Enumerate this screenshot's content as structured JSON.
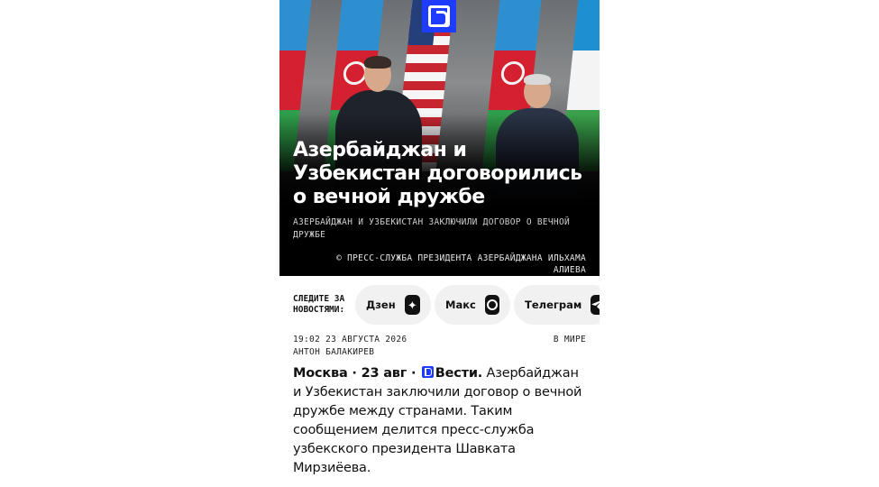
{
  "hero": {
    "title": "Азербайджан и Узбекистан договорились о вечной дружбе",
    "subtitle": "АЗЕРБАЙДЖАН И УЗБЕКИСТАН ЗАКЛЮЧИЛИ ДОГОВОР О ВЕЧНОЙ ДРУЖБЕ",
    "credit": "© ПРЕСС-СЛУЖБА ПРЕЗИДЕНТА АЗЕРБАЙДЖАНА ИЛЬХАМА АЛИЕВА"
  },
  "follow": {
    "label_line1": "СЛЕДИТЕ ЗА",
    "label_line2": "НОВОСТЯМИ:",
    "channels": [
      {
        "label": "Дзен",
        "icon": "dzen-star-icon"
      },
      {
        "label": "Макс",
        "icon": "maks-chat-icon"
      },
      {
        "label": "Телеграм",
        "icon": "telegram-plane-icon"
      }
    ]
  },
  "meta": {
    "datetime": "19:02 23 АВГУСТА 2026",
    "category": "В МИРЕ",
    "author": "АНТОН БАЛАКИРЕВ"
  },
  "article": {
    "lead_city": "Москва · 23 авг ·",
    "lead_brand": "Вести.",
    "body": " Азербайджан и Узбекистан заключили договор о вечной дружбе между странами. Таким сообщением делится пресс-служба узбекского президента Шавката Мирзиёева."
  },
  "colors": {
    "brand_blue": "#1d3cff",
    "pill_bg": "#f1f1f1"
  }
}
